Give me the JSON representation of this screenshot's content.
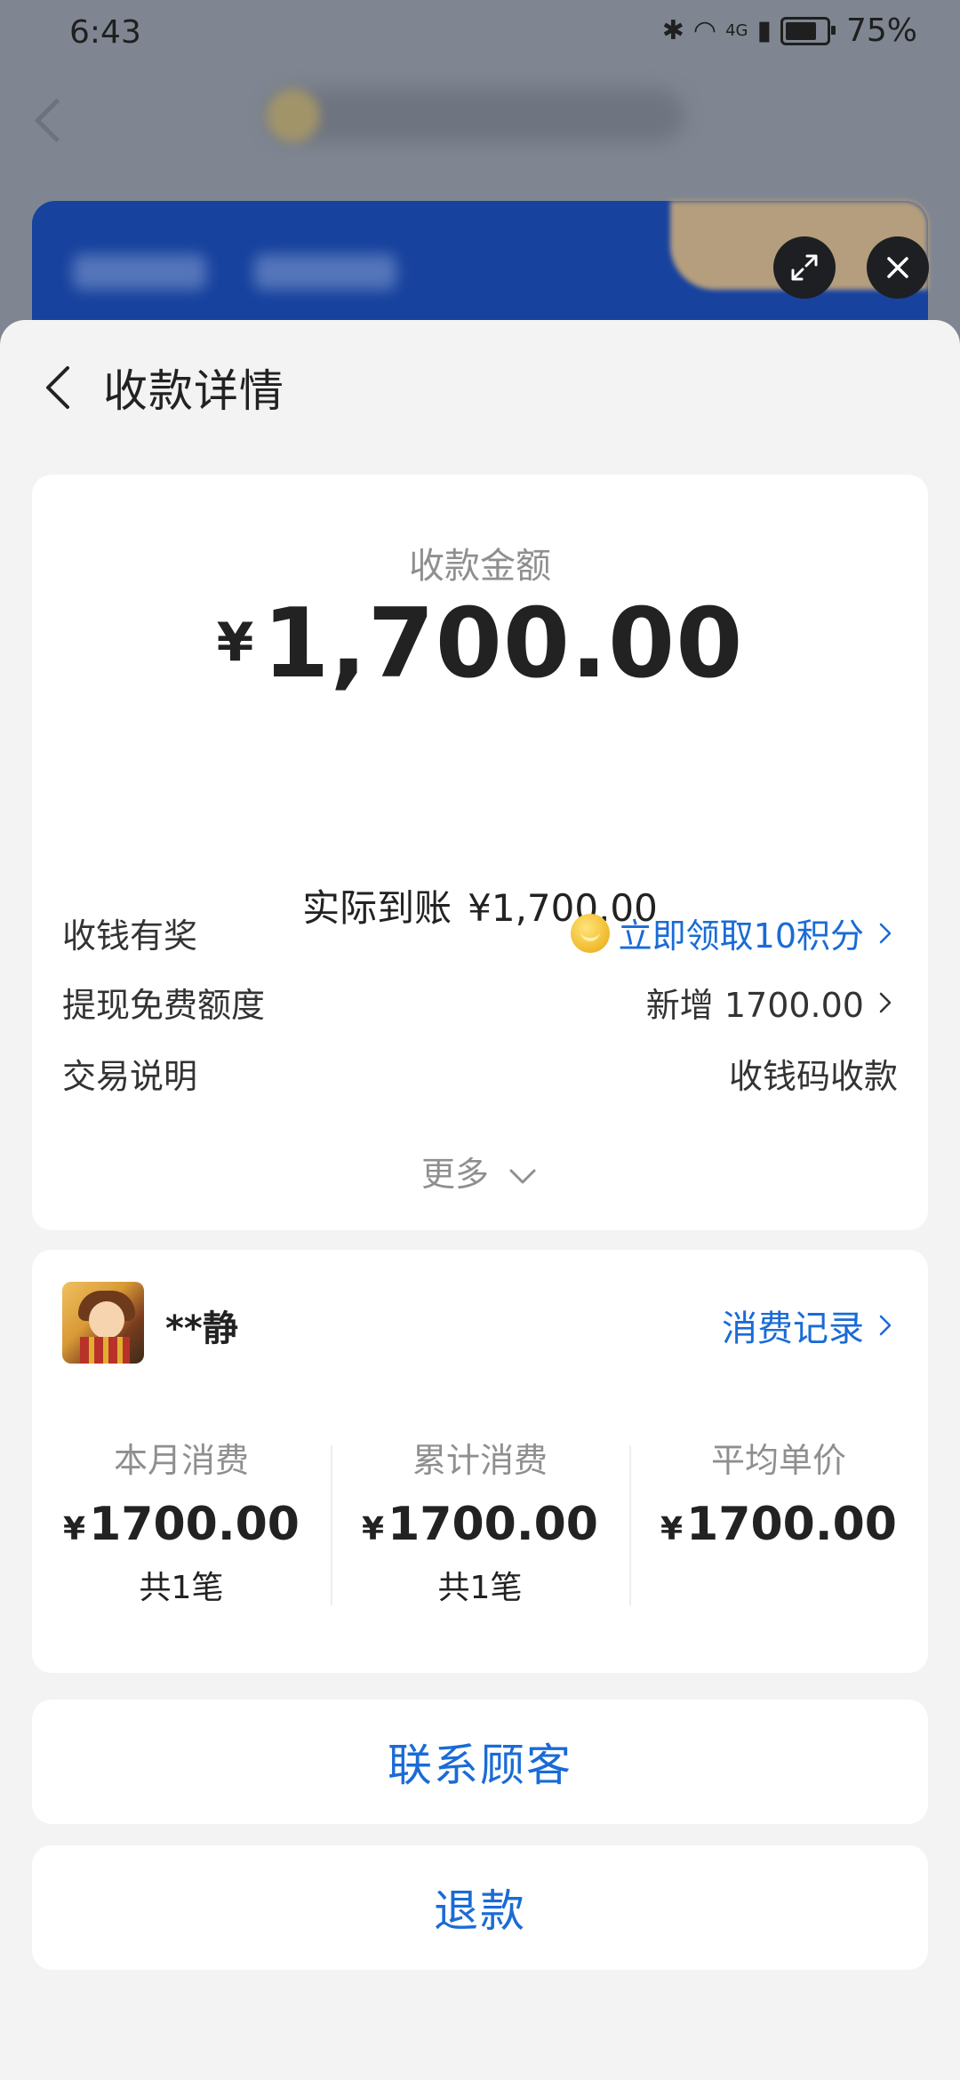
{
  "status_bar": {
    "time": "6:43",
    "battery": "75%",
    "network": "4G"
  },
  "sheet": {
    "title": "收款详情"
  },
  "amount_card": {
    "label": "收款金额",
    "currency": "¥",
    "amount": "1,700.00",
    "actual_label": "实际到账",
    "actual_value": "¥1,700.00",
    "rows": [
      {
        "label": "收钱有奖",
        "value": "立即领取10积分"
      },
      {
        "label": "提现免费额度",
        "value": "新增 1700.00"
      },
      {
        "label": "交易说明",
        "value": "收钱码收款"
      }
    ],
    "more_label": "更多"
  },
  "customer_card": {
    "name": "**静",
    "record_link": "消费记录",
    "stats": [
      {
        "label": "本月消费",
        "currency": "¥",
        "value": "1700.00",
        "count": "共1笔"
      },
      {
        "label": "累计消费",
        "currency": "¥",
        "value": "1700.00",
        "count": "共1笔"
      },
      {
        "label": "平均单价",
        "currency": "¥",
        "value": "1700.00",
        "count": ""
      }
    ]
  },
  "actions": {
    "contact": "联系顾客",
    "refund": "退款"
  },
  "colors": {
    "accent": "#1a6bd6",
    "background": "#f3f3f3",
    "card": "#ffffff"
  }
}
